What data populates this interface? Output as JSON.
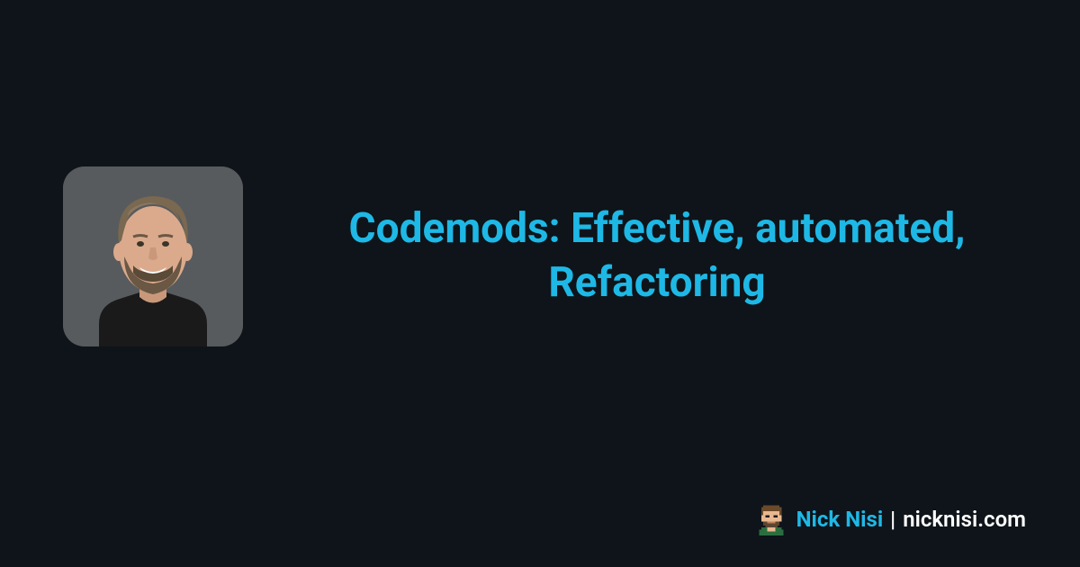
{
  "title": "Codemods: Effective, automated, Refactoring",
  "author": {
    "name": "Nick Nisi",
    "site": "nicknisi.com"
  },
  "colors": {
    "background": "#0e1419",
    "accent": "#1eb8e6"
  }
}
